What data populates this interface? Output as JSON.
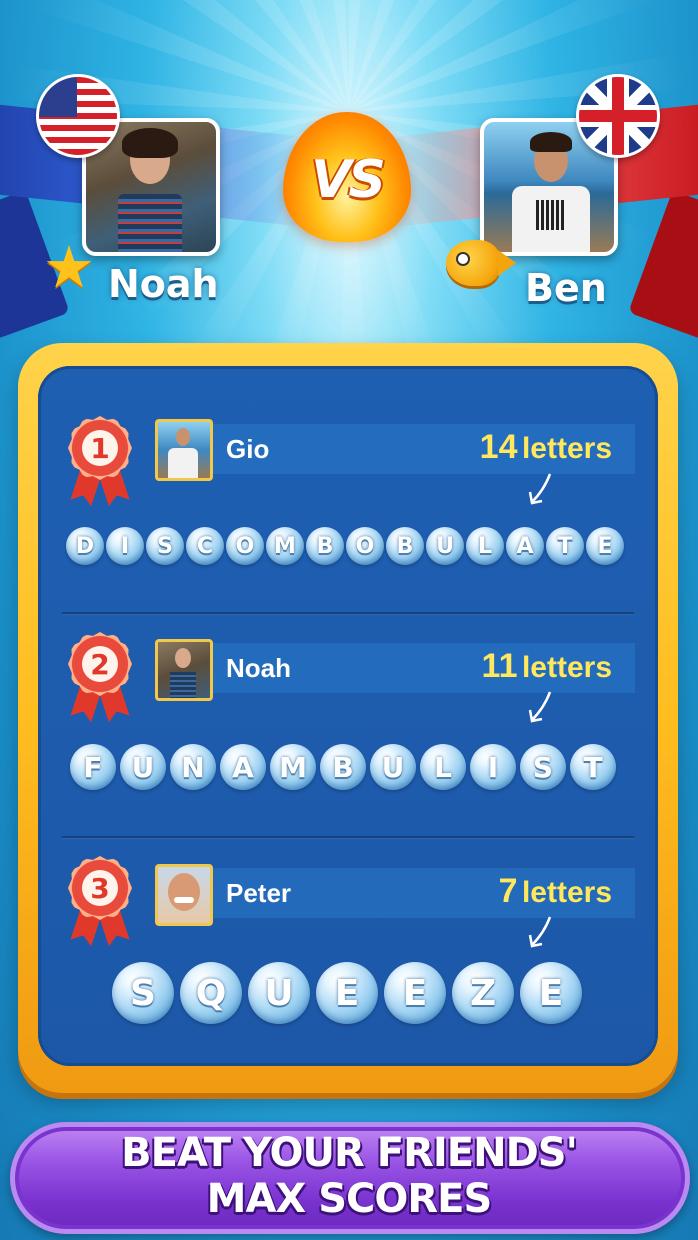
{
  "header": {
    "left_player": {
      "name": "Noah",
      "flag": "usa-flag",
      "mascot": "starfish-mascot"
    },
    "right_player": {
      "name": "Ben",
      "flag": "uk-flag",
      "mascot": "goldfish-mascot"
    },
    "versus_label": "VS"
  },
  "leaderboard": {
    "rows": [
      {
        "rank": "1",
        "name": "Gio",
        "score_number": "14",
        "score_unit": "letters",
        "word": [
          "D",
          "I",
          "S",
          "C",
          "O",
          "M",
          "B",
          "O",
          "B",
          "U",
          "L",
          "A",
          "T",
          "E"
        ]
      },
      {
        "rank": "2",
        "name": "Noah",
        "score_number": "11",
        "score_unit": "letters",
        "word": [
          "F",
          "U",
          "N",
          "A",
          "M",
          "B",
          "U",
          "L",
          "I",
          "S",
          "T"
        ]
      },
      {
        "rank": "3",
        "name": "Peter",
        "score_number": "7",
        "score_unit": "letters",
        "word": [
          "S",
          "Q",
          "U",
          "E",
          "E",
          "Z",
          "E"
        ]
      }
    ]
  },
  "banner": {
    "line1": "BEAT YOUR FRIENDS'",
    "line2": "MAX SCORES"
  },
  "colors": {
    "background": "#2fb4e4",
    "board_frame": "#ffbd1f",
    "board_panel": "#1e5fb2",
    "score_text": "#ffe75e",
    "medal": "#e84a3c",
    "banner": "#7a33cf",
    "ribbon_left": "#1f3fa8",
    "ribbon_right": "#c4161c"
  }
}
